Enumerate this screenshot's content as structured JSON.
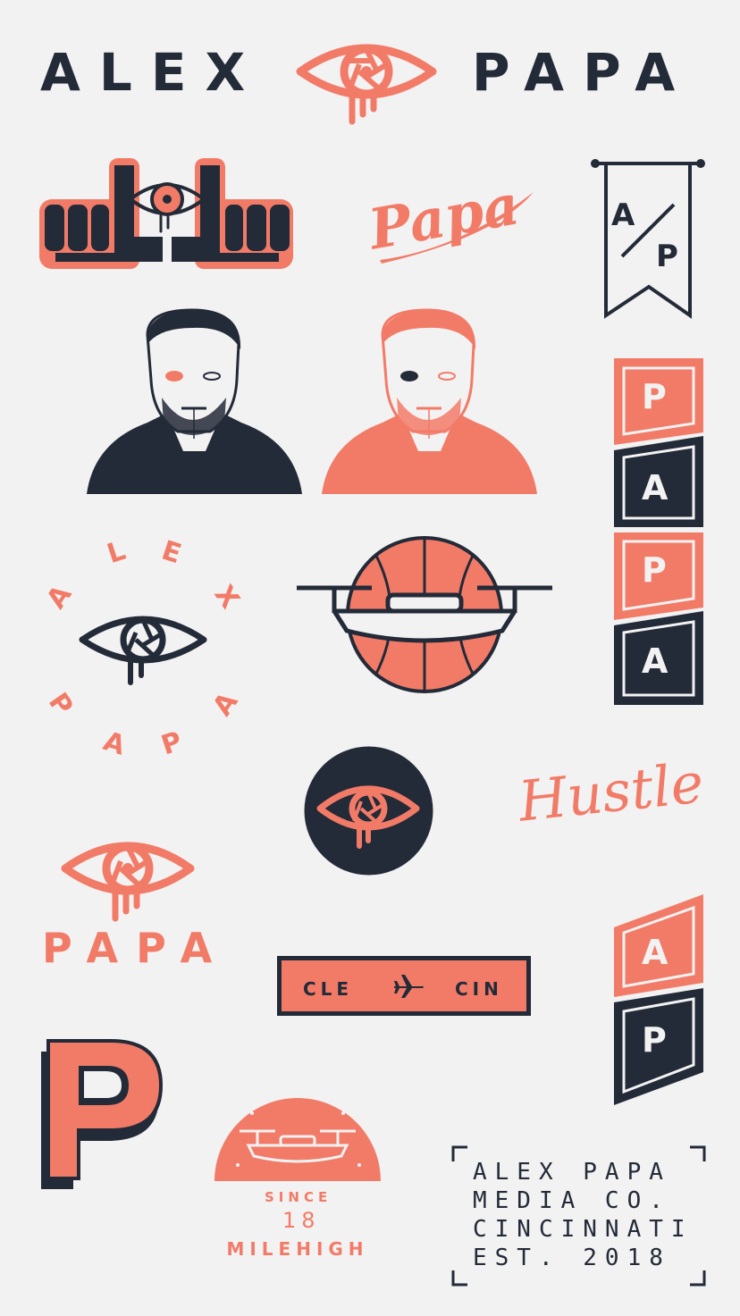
{
  "colors": {
    "background": "#f3f2f2",
    "navy": "#232a38",
    "coral": "#f27b68",
    "cream": "#f3f2f2"
  },
  "header": {
    "left_word": "ALEX",
    "right_word": "PAPA",
    "center_icon": "eye-shutter-icon"
  },
  "script_logo": {
    "text": "Papa"
  },
  "pennant": {
    "top_letter": "A",
    "bottom_letter": "P",
    "slash": "/"
  },
  "stacked_banner": {
    "letters": [
      "P",
      "A",
      "P",
      "A"
    ]
  },
  "circular_badge": {
    "top_letters": [
      "A",
      "L",
      "E",
      "X"
    ],
    "bottom_letters": [
      "P",
      "A",
      "P",
      "A"
    ],
    "icon": "eye-shutter-icon"
  },
  "hustle": {
    "text": "Hustle"
  },
  "papa_logo": {
    "word": "PAPA",
    "icon": "eye-shutter-icon"
  },
  "flight_badge": {
    "from": "CLE",
    "to": "CIN",
    "icon": "airplane-icon"
  },
  "small_banner": {
    "letters": [
      "A",
      "P"
    ]
  },
  "p_monogram": {
    "letter": "P"
  },
  "milehigh_badge": {
    "since": "SINCE",
    "year": "18",
    "arc_text": "MILEHIGH",
    "icon": "drone-icon"
  },
  "info_block": {
    "lines": [
      "ALEX PAPA",
      "MEDIA CO.",
      "CINCINNATI",
      "EST. 2018"
    ]
  },
  "portraits": [
    {
      "style": "navy"
    },
    {
      "style": "coral"
    }
  ]
}
